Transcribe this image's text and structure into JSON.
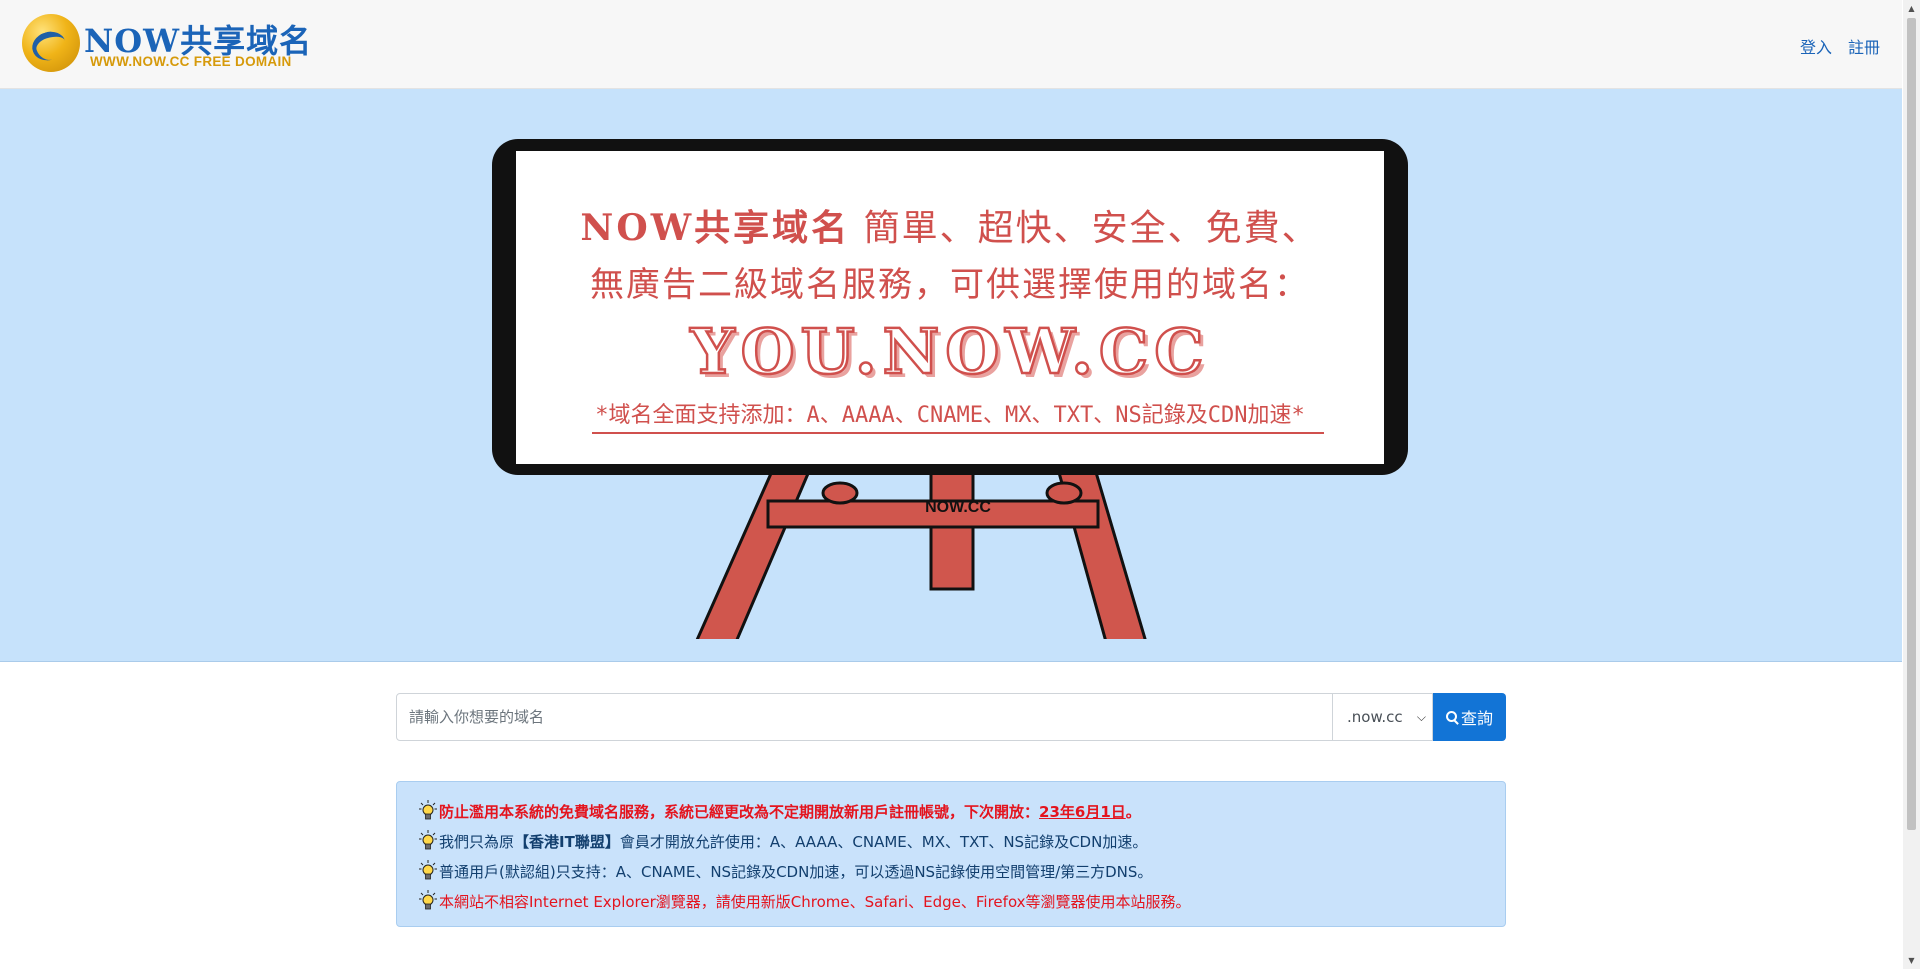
{
  "header": {
    "logo_title": "NOW共享域名",
    "logo_subtitle": "WWW.NOW.CC FREE DOMAIN",
    "login_label": "登入",
    "register_label": "註冊"
  },
  "banner": {
    "brand": "NOW共享域名",
    "line1_rest": " 簡單、超快、安全、免費、",
    "line2": "無廣告二級域名服務，可供選擇使用的域名：",
    "domain": "YOU.NOW.CC",
    "note": "*域名全面支持添加：A、AAAA、CNAME、MX、TXT、NS記錄及CDN加速*",
    "easel_label": "NOW.CC"
  },
  "search": {
    "placeholder": "請輸入你想要的域名",
    "tld_selected": ".now.cc",
    "button_label": "查詢"
  },
  "notices": {
    "line1_text": "防止濫用本系統的免費域名服務，系統已經更改為不定期開放新用戶註冊帳號，下次開放：",
    "line1_date": "23年6月1日",
    "line1_end": "。",
    "line2_pre": "我們只為原",
    "line2_org": "【香港IT聯盟】",
    "line2_post": "會員才開放允許使用：A、AAAA、CNAME、MX、TXT、NS記錄及CDN加速。",
    "line3": "普通用戶(默認組)只支持：A、CNAME、NS記錄及CDN加速，可以透過NS記錄使用空間管理/第三方DNS。",
    "line4": "本網站不相容Internet Explorer瀏覽器，請使用新版Chrome、Safari、Edge、Firefox等瀏覽器使用本站服務。"
  },
  "colors": {
    "accent": "#1274d6",
    "banner_bg": "#c6e2fb",
    "banner_text": "#d0504d",
    "warning": "#e4141e",
    "info_text": "#123f6e"
  },
  "icons": {
    "notice": "lightbulb-icon",
    "search": "search-icon",
    "select": "chevron-down-icon"
  }
}
